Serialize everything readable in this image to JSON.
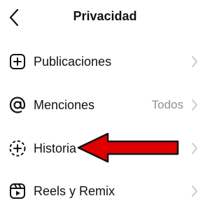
{
  "header": {
    "title": "Privacidad",
    "back_icon": "chevron-left-icon"
  },
  "menu": {
    "items": [
      {
        "label": "Publicaciones",
        "value": "",
        "icon": "plus-square-icon"
      },
      {
        "label": "Menciones",
        "value": "Todos",
        "icon": "at-sign-icon"
      },
      {
        "label": "Historia",
        "value": "",
        "icon": "story-add-icon"
      },
      {
        "label": "Reels y Remix",
        "value": "",
        "icon": "reels-icon"
      }
    ]
  },
  "colors": {
    "text": "#111111",
    "secondary_text": "#8e8e8e",
    "chevron": "#c7c7cc",
    "annotation_arrow": "#e00000"
  }
}
